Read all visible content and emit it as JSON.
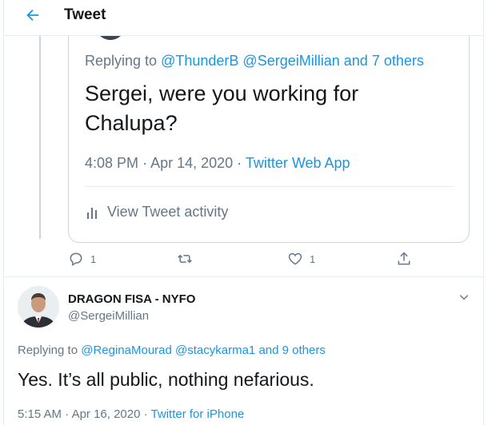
{
  "header": {
    "title": "Tweet"
  },
  "quoted_tweet": {
    "replying_prefix": "Replying to",
    "replying_mentions": [
      "@ThunderB",
      "@SergeiMillian"
    ],
    "replying_and": "and",
    "replying_others": "7 others",
    "text": "Sergei, were you working for Chalupa?",
    "time": "4:08 PM",
    "date": "Apr 14, 2020",
    "source": "Twitter Web App",
    "activity_label": "View Tweet activity"
  },
  "actions": {
    "reply_count": "1",
    "retweet_count": "",
    "like_count": "1"
  },
  "reply_tweet": {
    "author_name": "DRAGON FISA - NYFO",
    "author_handle": "@SergeiMillian",
    "replying_prefix": "Replying to",
    "replying_mentions": [
      "@ReginaMourad",
      "@stacykarma1"
    ],
    "replying_and": "and",
    "replying_others": "9 others",
    "text": "Yes. It’s all public, nothing nefarious.",
    "time": "5:15 AM",
    "date": "Apr 16, 2020",
    "source": "Twitter for iPhone"
  },
  "colors": {
    "accent": "#1b95e0",
    "secondary_text": "#657786",
    "border": "#e6ecf0"
  },
  "icons": [
    "back-arrow-icon",
    "bar-chart-icon",
    "reply-icon",
    "retweet-icon",
    "heart-icon",
    "share-icon",
    "chevron-down-icon"
  ]
}
